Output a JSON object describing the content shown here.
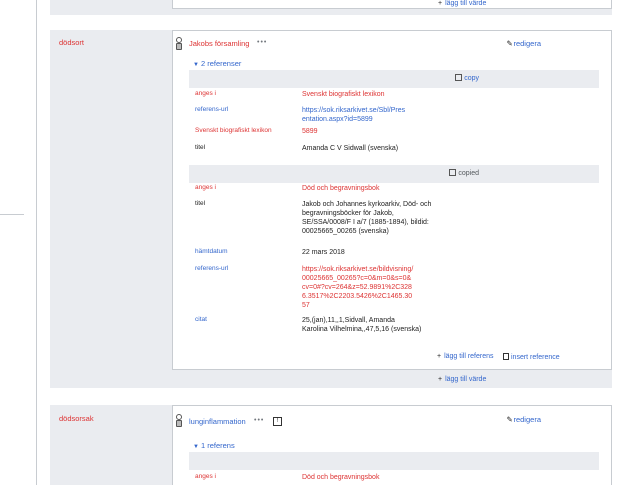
{
  "top": {
    "add_value_label": "lägg till värde"
  },
  "dodsort": {
    "property_label": "dödsort",
    "value": "Jakobs församling",
    "edit_label": "redigera",
    "references_toggle": "2 referenser",
    "ref1": {
      "copy_label": "copy",
      "rows": [
        {
          "key": "anges i",
          "value": "Svenskt biografiskt lexikon"
        },
        {
          "key": "referens-url",
          "value": "https://sok.riksarkivet.se/Sbl/Presentation.aspx?id=5899"
        },
        {
          "key": "Svenskt biografiskt lexikon",
          "value": "5899"
        },
        {
          "key": "titel",
          "value": "Amanda C V Sidwall (svenska)"
        }
      ]
    },
    "ref2": {
      "copy_label": "copied",
      "rows": [
        {
          "key": "anges i",
          "value": "Död och begravningsbok"
        },
        {
          "key": "titel",
          "value": "Jakob och Johannes kyrkoarkiv, Död- och begravningsböcker för Jakob, SE/SSA/0008/F I a/7 (1885-1894), bildid: 00025665_00265 (svenska)"
        },
        {
          "key": "hämtdatum",
          "value": "22 mars 2018"
        },
        {
          "key": "referens-url",
          "value": "https://sok.riksarkivet.se/bildvisning/00025665_00265?c=0&m=0&s=0&cv=0#?cv=264&z=52.9891%2C3286.3517%2C2203.5426%2C1465.3057"
        },
        {
          "key": "citat",
          "value": "25,(jan),11,,1,Sidvall, Amanda Karolina Vilhelmina,,47,5,16 (svenska)"
        }
      ]
    },
    "add_reference_label": "lägg till referens",
    "insert_reference_label": "insert reference",
    "add_value_label": "lägg till värde"
  },
  "dodsorsak": {
    "property_label": "dödsorsak",
    "value": "lunginflammation",
    "qualifier_icon_text": "!",
    "edit_label": "redigera",
    "references_toggle": "1 referens",
    "ref1": {
      "rows": [
        {
          "key": "anges i",
          "value": "Död och begravningsbok"
        }
      ]
    }
  }
}
